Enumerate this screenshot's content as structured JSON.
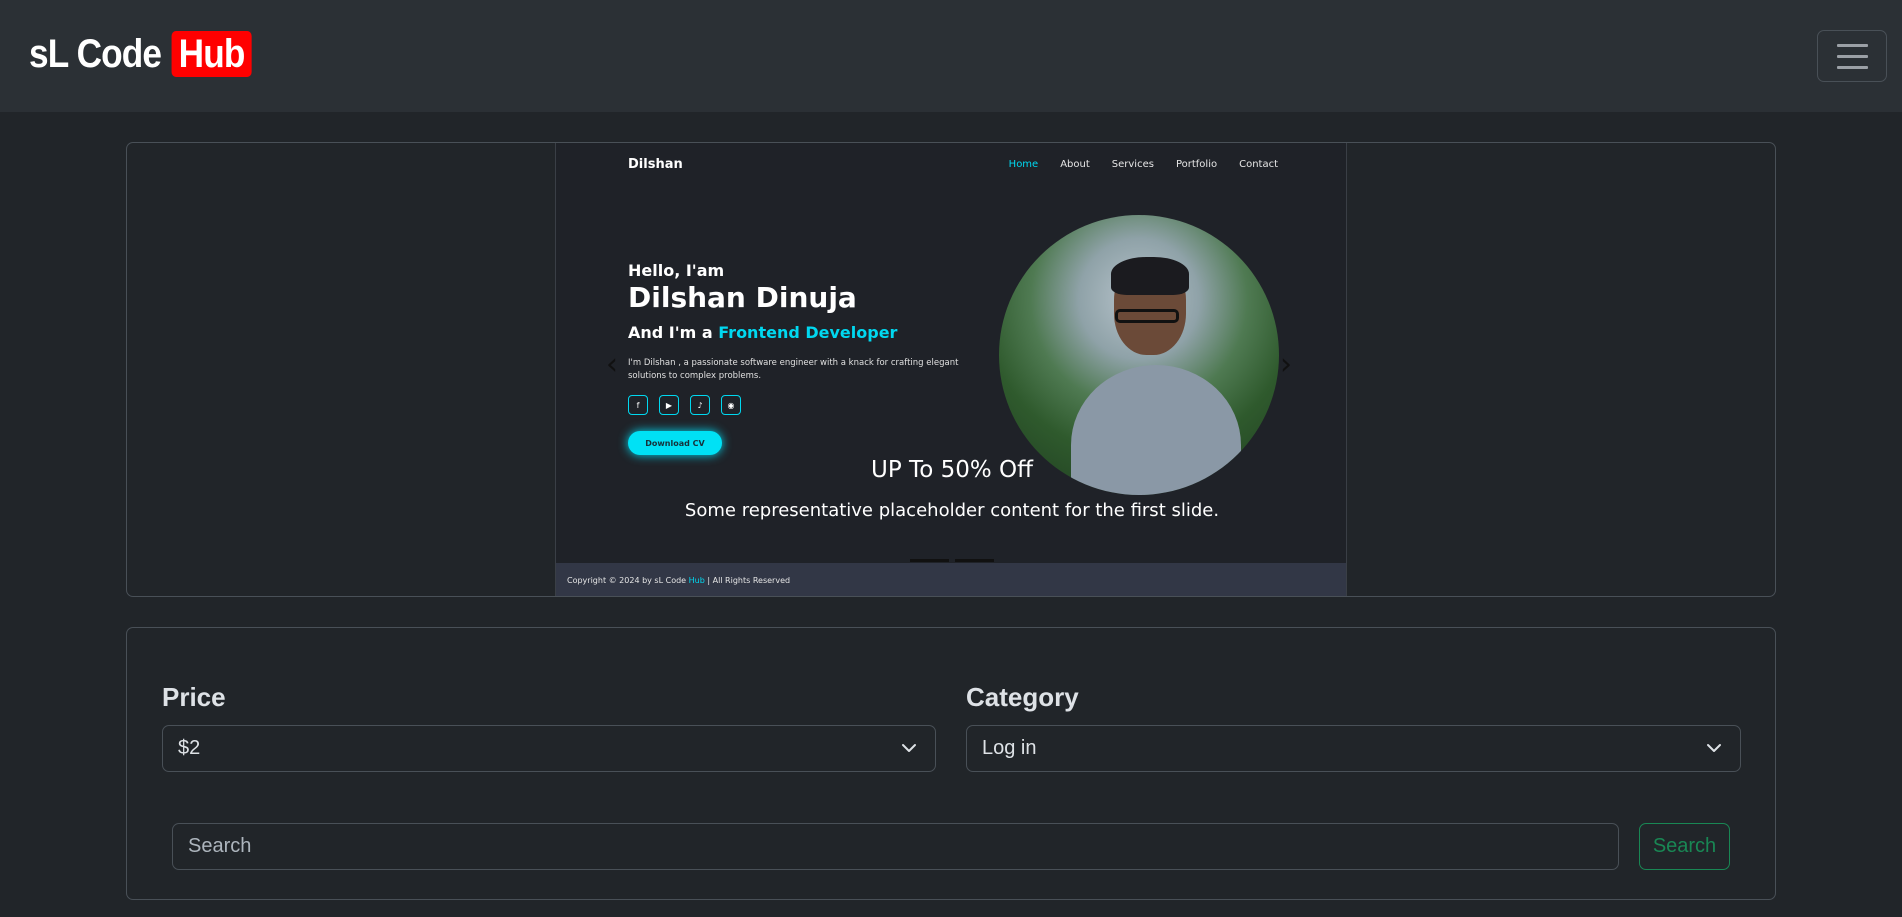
{
  "navbar": {
    "brand_main": "sL Code",
    "brand_highlight": "Hub",
    "brand_highlight_color": "#ff0000",
    "toggler_icon": "hamburger-menu-icon"
  },
  "carousel": {
    "slide": {
      "site_brand": "Dilshan",
      "nav": [
        "Home",
        "About",
        "Services",
        "Portfolio",
        "Contact"
      ],
      "active_nav": "Home",
      "hello": "Hello, I'am",
      "name": "Dilshan Dinuja",
      "role_prefix": "And I'm a",
      "role_highlight": "Frontend Developer",
      "description": "I'm Dilshan , a passionate software engineer with a knack for crafting elegant solutions to complex problems.",
      "social_icons": [
        "facebook-icon",
        "youtube-icon",
        "tiktok-icon",
        "github-icon"
      ],
      "cta": "Download CV",
      "footer_prefix": "Copyright © 2024 by sL Code",
      "footer_highlight": "Hub",
      "footer_suffix": "| All Rights Reserved",
      "accent_color": "#00d8f0"
    },
    "caption_title": "UP To 50% Off",
    "caption_text": "Some representative placeholder content for the first slide.",
    "indicator_count": 2
  },
  "filters": {
    "price_label": "Price",
    "price_value": "$2",
    "category_label": "Category",
    "category_value": "Log in",
    "search_placeholder": "Search",
    "search_button": "Search",
    "search_button_color": "#198754"
  }
}
